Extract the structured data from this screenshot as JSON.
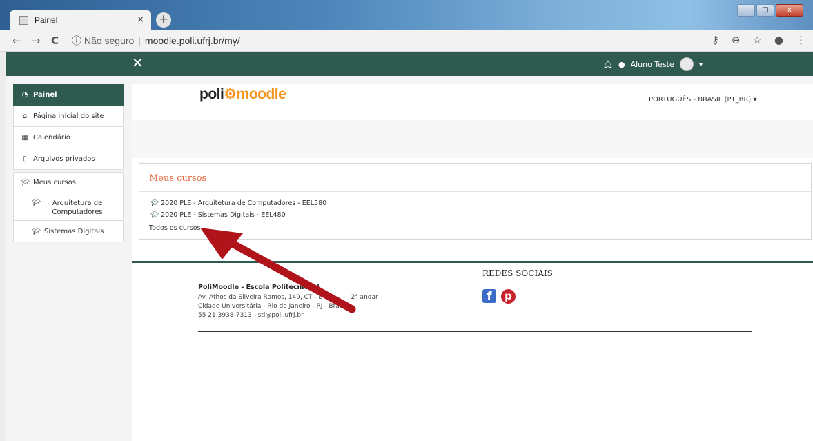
{
  "browser": {
    "tab_title": "Painel",
    "tab_close": "×",
    "new_tab": "+",
    "back": "←",
    "forward": "→",
    "reload": "C",
    "security_icon": "ⓘ",
    "security_label": "Não seguro",
    "url": "moodle.poli.ufrj.br/my/",
    "win_min": "–",
    "win_max": "□",
    "win_close": "x"
  },
  "navbar": {
    "close": "✕",
    "user_name": "Aluno Teste",
    "caret": "▾"
  },
  "sidebar": {
    "items": [
      {
        "label": "Painel",
        "icon": "dashboard-icon"
      },
      {
        "label": "Página inicial do site",
        "icon": "home-icon"
      },
      {
        "label": "Calendário",
        "icon": "calendar-icon"
      },
      {
        "label": "Arquivos privados",
        "icon": "file-icon"
      },
      {
        "label": "Meus cursos",
        "icon": "graduation-cap-icon"
      },
      {
        "label": "Arquitetura de Computadores",
        "icon": "graduation-cap-icon"
      },
      {
        "label": "Sistemas Digitais",
        "icon": "graduation-cap-icon"
      }
    ]
  },
  "header": {
    "logo_part1": "poli",
    "logo_part2": "moodle",
    "language": "PORTUGUÊS - BRASIL (PT_BR) ▾"
  },
  "courses_block": {
    "title": "Meus cursos",
    "courses": [
      "2020 PLE - Arquitetura de Computadores - EEL580",
      "2020 PLE - Sistemas Digitais - EEL480"
    ],
    "all_courses": "Todos os cursos ..."
  },
  "footer": {
    "org_name": "PoliMoodle - Escola Politécnica d",
    "address_1": "Av. Athos da Silveira Ramos, 149, CT - B",
    "address_1b": "2° andar",
    "address_2": "Cidade Universitária - Rio de Janeiro - RJ - Bras",
    "contact": "55 21 3938-7313 - sti@poli.ufrj.br",
    "social_title": "REDES SOCIAIS",
    "dot": "."
  },
  "annotation": {
    "arrow_color": "#b0141a"
  }
}
